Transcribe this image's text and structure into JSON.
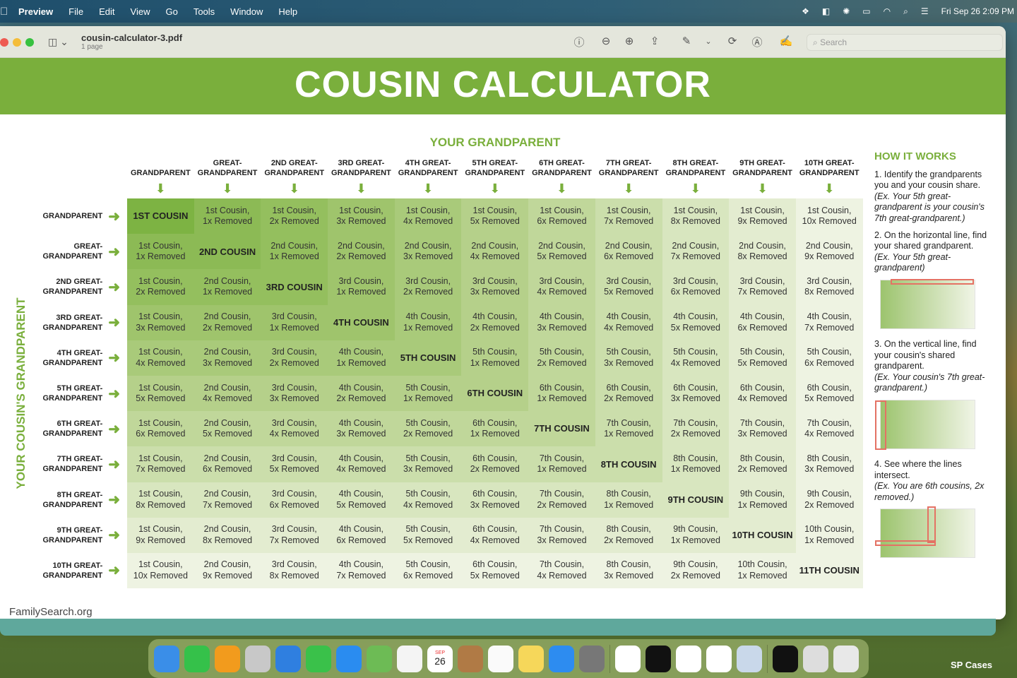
{
  "menubar": {
    "app": "Preview",
    "items": [
      "File",
      "Edit",
      "View",
      "Go",
      "Tools",
      "Window",
      "Help"
    ],
    "status_icons": [
      "dropbox-icon",
      "teams-icon",
      "bug-icon",
      "battery-icon",
      "wifi-icon",
      "spotlight-icon",
      "control-center-icon"
    ],
    "clock": "Fri Sep 26  2:09 PM"
  },
  "window": {
    "title": "cousin-calculator-3.pdf",
    "subtitle": "1 page",
    "search_placeholder": "Search",
    "tools": [
      "info-icon",
      "zoom-out-icon",
      "zoom-in-icon",
      "share-icon",
      "markup-pen-icon",
      "chevron-down-icon",
      "rotate-icon",
      "annotate-icon",
      "sign-icon"
    ]
  },
  "doc": {
    "title": "COUSIN CALCULATOR",
    "top_axis": "YOUR GRANDPARENT",
    "side_axis": "YOUR COUSIN'S GRANDPARENT",
    "headers": [
      "GRANDPARENT",
      "GREAT-\nGRANDPARENT",
      "2ND GREAT-\nGRANDPARENT",
      "3RD GREAT-\nGRANDPARENT",
      "4TH GREAT-\nGRANDPARENT",
      "5TH GREAT-\nGRANDPARENT",
      "6TH GREAT-\nGRANDPARENT",
      "7TH GREAT-\nGRANDPARENT",
      "8TH GREAT-\nGRANDPARENT",
      "9TH GREAT-\nGRANDPARENT",
      "10TH GREAT-\nGRANDPARENT"
    ],
    "colors": {
      "accent": "#7aaf3c",
      "shades": [
        "#7db343",
        "#8cba55",
        "#94bf5e",
        "#9fc46c",
        "#a9ca7a",
        "#b5d08a",
        "#c0d79a",
        "#cbdeab",
        "#d8e6bf",
        "#e3ecd0",
        "#eef3e2"
      ]
    },
    "rows": [
      [
        "1ST COUSIN",
        "1st Cousin,\n1x Removed",
        "1st Cousin,\n2x Removed",
        "1st Cousin,\n3x Removed",
        "1st Cousin,\n4x Removed",
        "1st Cousin,\n5x Removed",
        "1st Cousin,\n6x Removed",
        "1st Cousin,\n7x Removed",
        "1st Cousin,\n8x Removed",
        "1st Cousin,\n9x Removed",
        "1st Cousin,\n10x Removed"
      ],
      [
        "1st Cousin,\n1x Removed",
        "2ND COUSIN",
        "2nd Cousin,\n1x Removed",
        "2nd Cousin,\n2x Removed",
        "2nd Cousin,\n3x Removed",
        "2nd Cousin,\n4x Removed",
        "2nd Cousin,\n5x Removed",
        "2nd Cousin,\n6x Removed",
        "2nd Cousin,\n7x Removed",
        "2nd Cousin,\n8x Removed",
        "2nd Cousin,\n9x Removed"
      ],
      [
        "1st Cousin,\n2x Removed",
        "2nd Cousin,\n1x Removed",
        "3RD COUSIN",
        "3rd Cousin,\n1x Removed",
        "3rd Cousin,\n2x Removed",
        "3rd Cousin,\n3x Removed",
        "3rd Cousin,\n4x Removed",
        "3rd Cousin,\n5x Removed",
        "3rd Cousin,\n6x Removed",
        "3rd Cousin,\n7x Removed",
        "3rd Cousin,\n8x Removed"
      ],
      [
        "1st Cousin,\n3x Removed",
        "2nd Cousin,\n2x Removed",
        "3rd Cousin,\n1x Removed",
        "4TH COUSIN",
        "4th Cousin,\n1x Removed",
        "4th Cousin,\n2x Removed",
        "4th Cousin,\n3x Removed",
        "4th Cousin,\n4x Removed",
        "4th Cousin,\n5x Removed",
        "4th Cousin,\n6x Removed",
        "4th Cousin,\n7x Removed"
      ],
      [
        "1st Cousin,\n4x Removed",
        "2nd Cousin,\n3x Removed",
        "3rd Cousin,\n2x Removed",
        "4th Cousin,\n1x Removed",
        "5TH COUSIN",
        "5th Cousin,\n1x Removed",
        "5th Cousin,\n2x Removed",
        "5th Cousin,\n3x Removed",
        "5th Cousin,\n4x Removed",
        "5th Cousin,\n5x Removed",
        "5th Cousin,\n6x Removed"
      ],
      [
        "1st Cousin,\n5x Removed",
        "2nd Cousin,\n4x Removed",
        "3rd Cousin,\n3x Removed",
        "4th Cousin,\n2x Removed",
        "5th Cousin,\n1x Removed",
        "6TH COUSIN",
        "6th Cousin,\n1x Removed",
        "6th Cousin,\n2x Removed",
        "6th Cousin,\n3x Removed",
        "6th Cousin,\n4x Removed",
        "6th Cousin,\n5x Removed"
      ],
      [
        "1st Cousin,\n6x Removed",
        "2nd Cousin,\n5x Removed",
        "3rd Cousin,\n4x Removed",
        "4th Cousin,\n3x Removed",
        "5th Cousin,\n2x Removed",
        "6th Cousin,\n1x Removed",
        "7TH COUSIN",
        "7th Cousin,\n1x Removed",
        "7th Cousin,\n2x Removed",
        "7th Cousin,\n3x Removed",
        "7th Cousin,\n4x Removed"
      ],
      [
        "1st Cousin,\n7x Removed",
        "2nd Cousin,\n6x Removed",
        "3rd Cousin,\n5x Removed",
        "4th Cousin,\n4x Removed",
        "5th Cousin,\n3x Removed",
        "6th Cousin,\n2x Removed",
        "7th Cousin,\n1x Removed",
        "8TH COUSIN",
        "8th Cousin,\n1x Removed",
        "8th Cousin,\n2x Removed",
        "8th Cousin,\n3x Removed"
      ],
      [
        "1st Cousin,\n8x Removed",
        "2nd Cousin,\n7x Removed",
        "3rd Cousin,\n6x Removed",
        "4th Cousin,\n5x Removed",
        "5th Cousin,\n4x Removed",
        "6th Cousin,\n3x Removed",
        "7th Cousin,\n2x Removed",
        "8th Cousin,\n1x Removed",
        "9TH COUSIN",
        "9th Cousin,\n1x Removed",
        "9th Cousin,\n2x Removed"
      ],
      [
        "1st Cousin,\n9x Removed",
        "2nd Cousin,\n8x Removed",
        "3rd Cousin,\n7x Removed",
        "4th Cousin,\n6x Removed",
        "5th Cousin,\n5x Removed",
        "6th Cousin,\n4x Removed",
        "7th Cousin,\n3x Removed",
        "8th Cousin,\n2x Removed",
        "9th Cousin,\n1x Removed",
        "10TH COUSIN",
        "10th Cousin,\n1x Removed"
      ],
      [
        "1st Cousin,\n10x Removed",
        "2nd Cousin,\n9x Removed",
        "3rd Cousin,\n8x Removed",
        "4th Cousin,\n7x Removed",
        "5th Cousin,\n6x Removed",
        "6th Cousin,\n5x Removed",
        "7th Cousin,\n4x Removed",
        "8th Cousin,\n3x Removed",
        "9th Cousin,\n2x Removed",
        "10th Cousin,\n1x Removed",
        "11TH COUSIN"
      ]
    ],
    "how": {
      "title": "HOW IT WORKS",
      "steps": [
        {
          "text": "1. Identify the grandparents you and your cousin share.",
          "example": "(Ex. Your 5th great-grandparent is your cousin's 7th great-grandparent.)"
        },
        {
          "text": "2. On the horizontal line, find your shared grandparent.",
          "example": "(Ex. Your 5th great-grandparent)"
        },
        {
          "text": "3. On the vertical line, find your cousin's shared grandparent.",
          "example": "(Ex. Your cousin's 7th great-grandparent.)"
        },
        {
          "text": "4. See where the lines intersect.",
          "example": "(Ex. You are 6th cousins, 2x removed.)"
        }
      ]
    },
    "footer": "FamilySearch.org"
  },
  "dock": {
    "apps": [
      "Finder",
      "Numbers",
      "Pages",
      "Launchpad",
      "Safari",
      "Messages",
      "Mail",
      "Maps",
      "Photos",
      "Calendar",
      "Contacts",
      "Reminders",
      "Notes",
      "App Store",
      "System Settings",
      "Keychain",
      "Perplexity",
      "Teams",
      "Word",
      "Preview",
      "ChatGPT",
      "Printer",
      "Trash"
    ],
    "calendar_month": "SEP",
    "calendar_day": "26"
  },
  "desktop_label": "SP Cases"
}
